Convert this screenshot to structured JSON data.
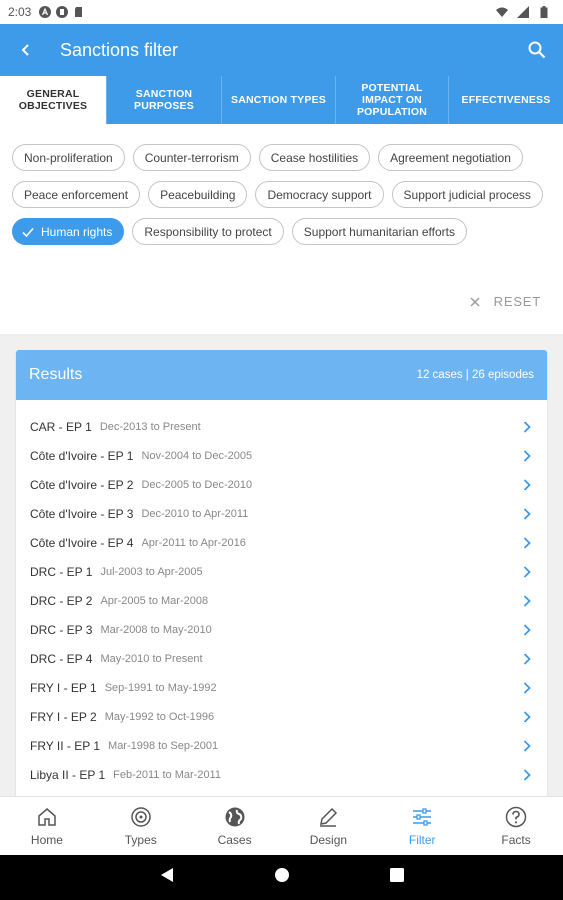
{
  "statusbar": {
    "time": "2:03"
  },
  "appbar": {
    "title": "Sanctions filter"
  },
  "tabs": [
    {
      "label": "GENERAL OBJECTIVES",
      "active": true
    },
    {
      "label": "SANCTION PURPOSES",
      "active": false
    },
    {
      "label": "SANCTION TYPES",
      "active": false
    },
    {
      "label": "POTENTIAL IMPACT ON POPULATION",
      "active": false
    },
    {
      "label": "EFFECTIVENESS",
      "active": false
    }
  ],
  "chips": [
    {
      "label": "Non-proliferation",
      "selected": false
    },
    {
      "label": "Counter-terrorism",
      "selected": false
    },
    {
      "label": "Cease hostilities",
      "selected": false
    },
    {
      "label": "Agreement negotiation",
      "selected": false
    },
    {
      "label": "Peace enforcement",
      "selected": false
    },
    {
      "label": "Peacebuilding",
      "selected": false
    },
    {
      "label": "Democracy support",
      "selected": false
    },
    {
      "label": "Support judicial process",
      "selected": false
    },
    {
      "label": "Human rights",
      "selected": true
    },
    {
      "label": "Responsibility to protect",
      "selected": false
    },
    {
      "label": "Support humanitarian efforts",
      "selected": false
    }
  ],
  "reset_label": "RESET",
  "results": {
    "title": "Results",
    "count": "12 cases | 26 episodes",
    "rows": [
      {
        "name": "CAR - EP 1",
        "dates": "Dec-2013 to Present"
      },
      {
        "name": "Côte d'Ivoire - EP 1",
        "dates": "Nov-2004 to Dec-2005"
      },
      {
        "name": "Côte d'Ivoire - EP 2",
        "dates": "Dec-2005 to Dec-2010"
      },
      {
        "name": "Côte d'Ivoire - EP 3",
        "dates": "Dec-2010 to Apr-2011"
      },
      {
        "name": "Côte d'Ivoire - EP 4",
        "dates": "Apr-2011 to Apr-2016"
      },
      {
        "name": "DRC - EP 1",
        "dates": "Jul-2003 to Apr-2005"
      },
      {
        "name": "DRC - EP 2",
        "dates": "Apr-2005 to Mar-2008"
      },
      {
        "name": "DRC - EP 3",
        "dates": "Mar-2008 to May-2010"
      },
      {
        "name": "DRC - EP 4",
        "dates": "May-2010 to Present"
      },
      {
        "name": "FRY I - EP 1",
        "dates": "Sep-1991 to May-1992"
      },
      {
        "name": "FRY I - EP 2",
        "dates": "May-1992 to Oct-1996"
      },
      {
        "name": "FRY II - EP 1",
        "dates": "Mar-1998 to Sep-2001"
      },
      {
        "name": "Libya II - EP 1",
        "dates": "Feb-2011 to Mar-2011"
      }
    ]
  },
  "bottomnav": [
    {
      "label": "Home",
      "icon": "home-icon",
      "active": false
    },
    {
      "label": "Types",
      "icon": "target-icon",
      "active": false
    },
    {
      "label": "Cases",
      "icon": "globe-icon",
      "active": false
    },
    {
      "label": "Design",
      "icon": "pencil-icon",
      "active": false
    },
    {
      "label": "Filter",
      "icon": "sliders-icon",
      "active": true
    },
    {
      "label": "Facts",
      "icon": "help-icon",
      "active": false
    }
  ],
  "colors": {
    "primary": "#3d9be9",
    "results_header": "#6cb4f2"
  }
}
